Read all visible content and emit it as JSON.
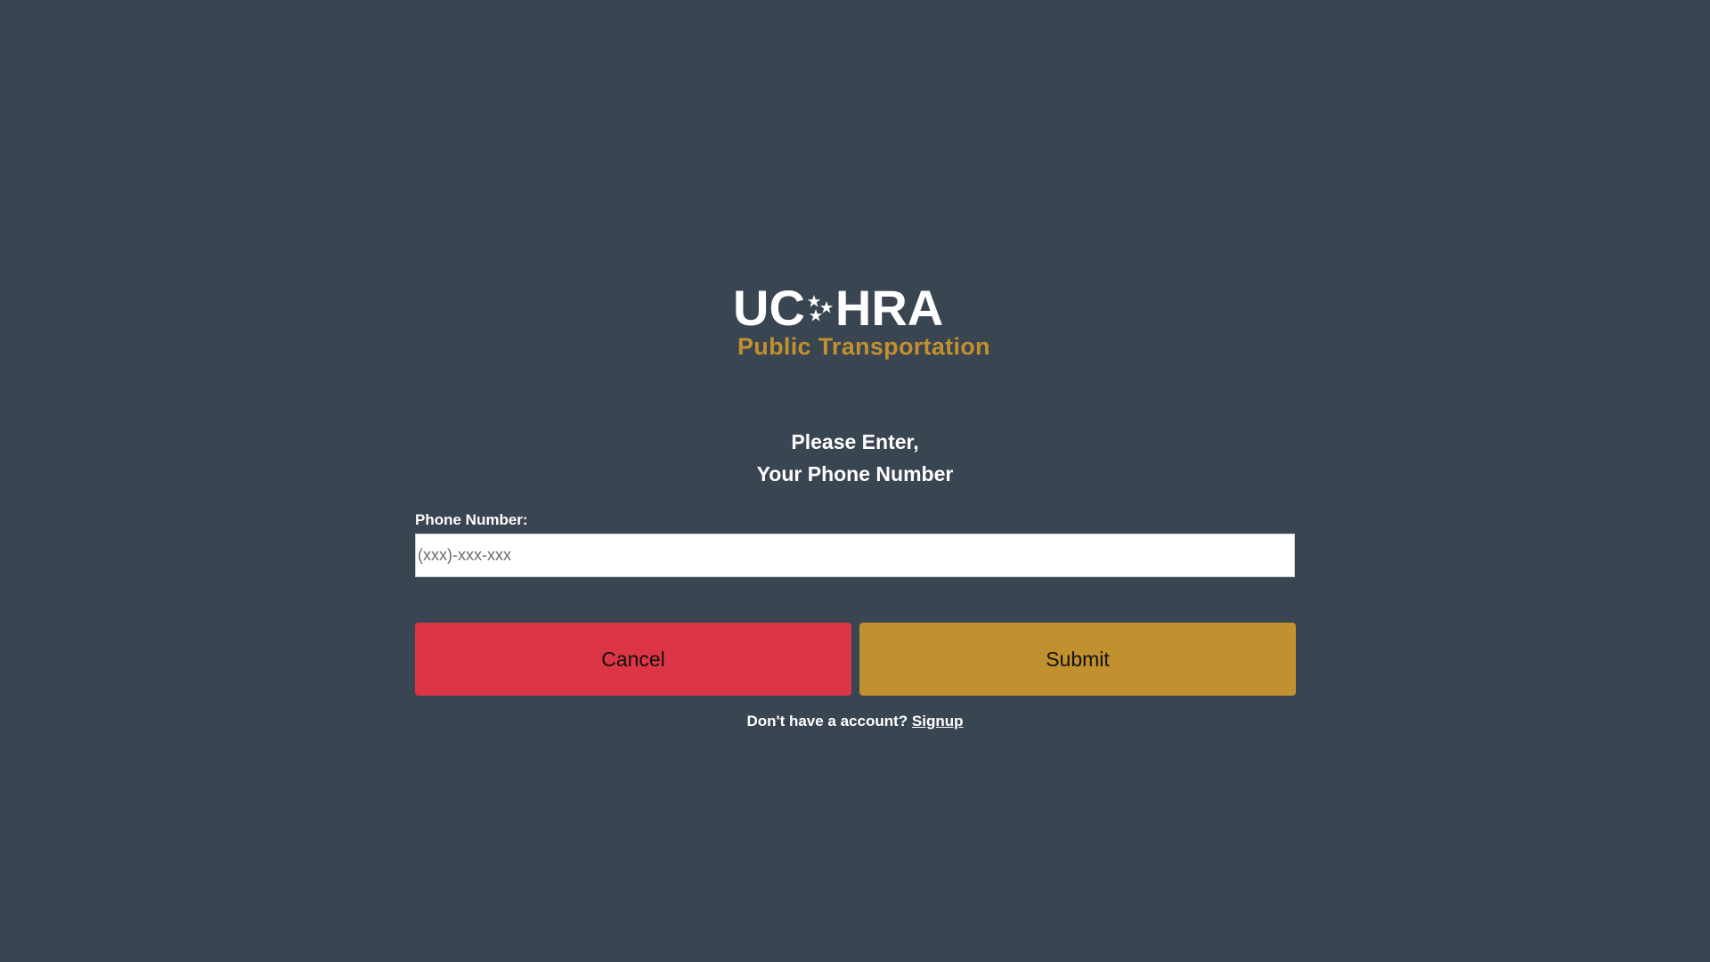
{
  "logo": {
    "main_left": "UC",
    "main_right": "HRA",
    "subtitle": "Public Transportation",
    "stars_icon": "stars-icon"
  },
  "prompt": {
    "line1": "Please Enter,",
    "line2": "Your Phone Number"
  },
  "phone": {
    "label": "Phone Number:",
    "placeholder": "(xxx)-xxx-xxx",
    "value": ""
  },
  "buttons": {
    "cancel_label": "Cancel",
    "submit_label": "Submit"
  },
  "signup": {
    "text": "Don't have a account?",
    "link_label": "Signup"
  },
  "colors": {
    "background": "#3a4552",
    "accent_gold": "#c1902f",
    "cancel_red": "#dc3545"
  }
}
